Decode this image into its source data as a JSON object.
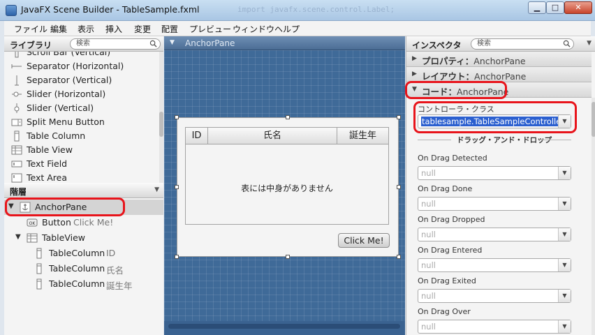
{
  "window": {
    "title": "JavaFX Scene Builder - TableSample.fxml",
    "ghost_text": "import javafx.scene.control.Label;",
    "min_glyph": "▁",
    "max_glyph": "□",
    "close_glyph": "✕"
  },
  "menu": [
    "ファイル",
    "編集",
    "表示",
    "挿入",
    "変更",
    "配置",
    "プレビュー",
    "ウィンドウ",
    "ヘルプ"
  ],
  "library": {
    "title": "ライブラリ",
    "search_placeholder": "検索",
    "items": [
      {
        "label": "Scroll Bar (Vertical)",
        "icon": "scrollbar-icon"
      },
      {
        "label": "Separator (Horizontal)",
        "icon": "separator-h-icon"
      },
      {
        "label": "Separator (Vertical)",
        "icon": "separator-v-icon"
      },
      {
        "label": "Slider (Horizontal)",
        "icon": "slider-h-icon"
      },
      {
        "label": "Slider (Vertical)",
        "icon": "slider-v-icon"
      },
      {
        "label": "Split Menu Button",
        "icon": "split-menu-icon"
      },
      {
        "label": "Table Column",
        "icon": "table-column-icon"
      },
      {
        "label": "Table View",
        "icon": "table-view-icon"
      },
      {
        "label": "Text Field",
        "icon": "text-field-icon"
      },
      {
        "label": "Text Area",
        "icon": "text-area-icon"
      }
    ]
  },
  "hierarchy": {
    "title": "階層",
    "rows": [
      {
        "name": "AnchorPane",
        "sub": "",
        "icon": "anchorpane-icon"
      },
      {
        "name": "Button",
        "sub": "Click Me!",
        "icon": "button-icon"
      },
      {
        "name": "TableView",
        "sub": "",
        "icon": "table-view-icon"
      },
      {
        "name": "TableColumn",
        "sub": "ID",
        "icon": "table-column-icon"
      },
      {
        "name": "TableColumn",
        "sub": "氏名",
        "icon": "table-column-icon"
      },
      {
        "name": "TableColumn",
        "sub": "誕生年",
        "icon": "table-column-icon"
      }
    ]
  },
  "canvas": {
    "breadcrumb": "AnchorPane",
    "table": {
      "columns": [
        "ID",
        "氏名",
        "誕生年"
      ],
      "empty_message": "表には中身がありません"
    },
    "button_label": "Click Me!"
  },
  "inspector": {
    "title": "インスペクタ",
    "search_placeholder": "検索",
    "sections": {
      "properties": {
        "title": "プロパティ",
        "value": "AnchorPane"
      },
      "layout": {
        "title": "レイアウト",
        "value": "AnchorPane"
      },
      "code": {
        "title": "コード",
        "value": "AnchorPane"
      }
    },
    "controller_label": "コントローラ・クラス",
    "controller_value": "tablesample.TableSampleController",
    "dnd_title": "ドラッグ・アンド・ドロップ",
    "fields": [
      {
        "label": "On Drag Detected",
        "value": "null"
      },
      {
        "label": "On Drag Done",
        "value": "null"
      },
      {
        "label": "On Drag Dropped",
        "value": "null"
      },
      {
        "label": "On Drag Entered",
        "value": "null"
      },
      {
        "label": "On Drag Exited",
        "value": "null"
      },
      {
        "label": "On Drag Over",
        "value": "null"
      }
    ]
  },
  "colors": {
    "highlight": "#e8141b",
    "canvas": "#3f6a98",
    "selection": "#2b5fcf"
  }
}
